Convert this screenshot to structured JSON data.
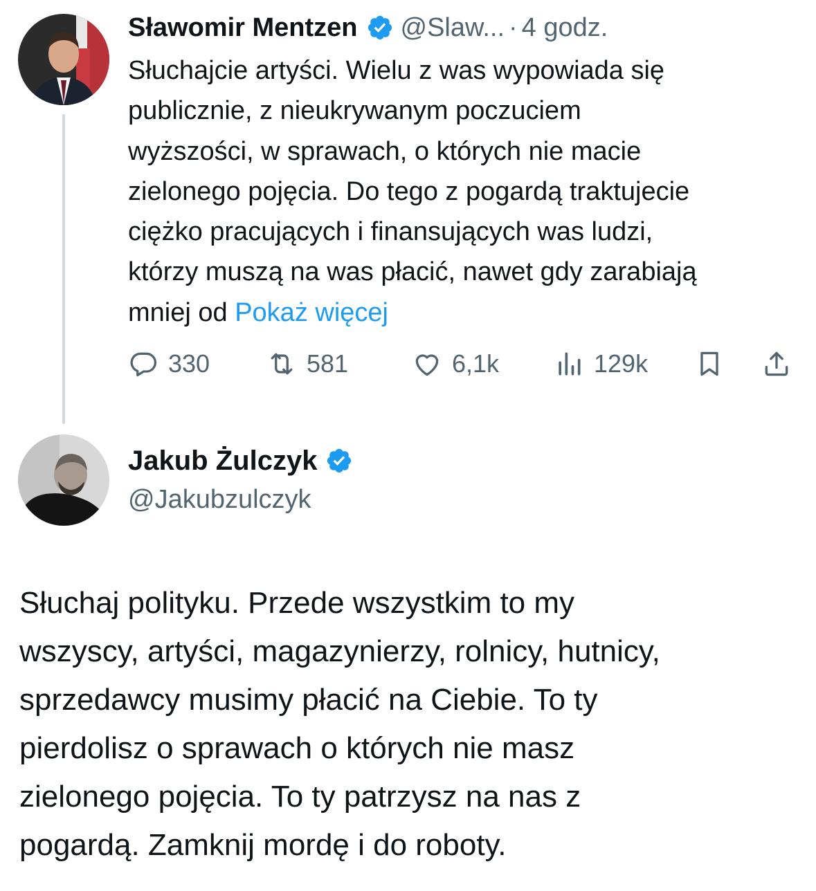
{
  "tweet1": {
    "author_name": "Sławomir Mentzen",
    "handle": "@Slaw...",
    "separator": "·",
    "time": "4 godz.",
    "body_lines": [
      "Słuchajcie artyści. Wielu z was wypowiada się",
      "publicznie, z nieukrywanym poczuciem",
      "wyższości, w sprawach, o których nie macie",
      "zielonego pojęcia. Do tego z pogardą traktujecie",
      "ciężko pracujących i finansujących was ludzi,",
      "którzy muszą na was płacić, nawet gdy zarabiają"
    ],
    "body_last_line": "mniej od",
    "show_more": "Pokaż więcej",
    "stats": {
      "replies": "330",
      "retweets": "581",
      "likes": "6,1k",
      "views": "129k"
    },
    "icons": [
      "reply-icon",
      "retweet-icon",
      "like-icon",
      "views-icon",
      "bookmark-icon",
      "share-icon",
      "verified-badge-icon"
    ]
  },
  "tweet2": {
    "author_name": "Jakub Żulczyk",
    "handle": "@Jakubzulczyk",
    "body_lines": [
      "Słuchaj polityku. Przede wszystkim to my",
      "wszyscy, artyści, magazynierzy, rolnicy, hutnicy,",
      "sprzedawcy musimy płacić na Ciebie. To ty",
      "pierdolisz o sprawach o których nie masz",
      "zielonego pojęcia. To ty patrzysz na nas z",
      "pogardą. Zamknij mordę i do roboty."
    ]
  },
  "colors": {
    "text": "#0f1419",
    "secondary": "#536471",
    "link": "#1d9bf0",
    "verified": "#1d9bf0",
    "thread_line": "#cfd9de"
  }
}
